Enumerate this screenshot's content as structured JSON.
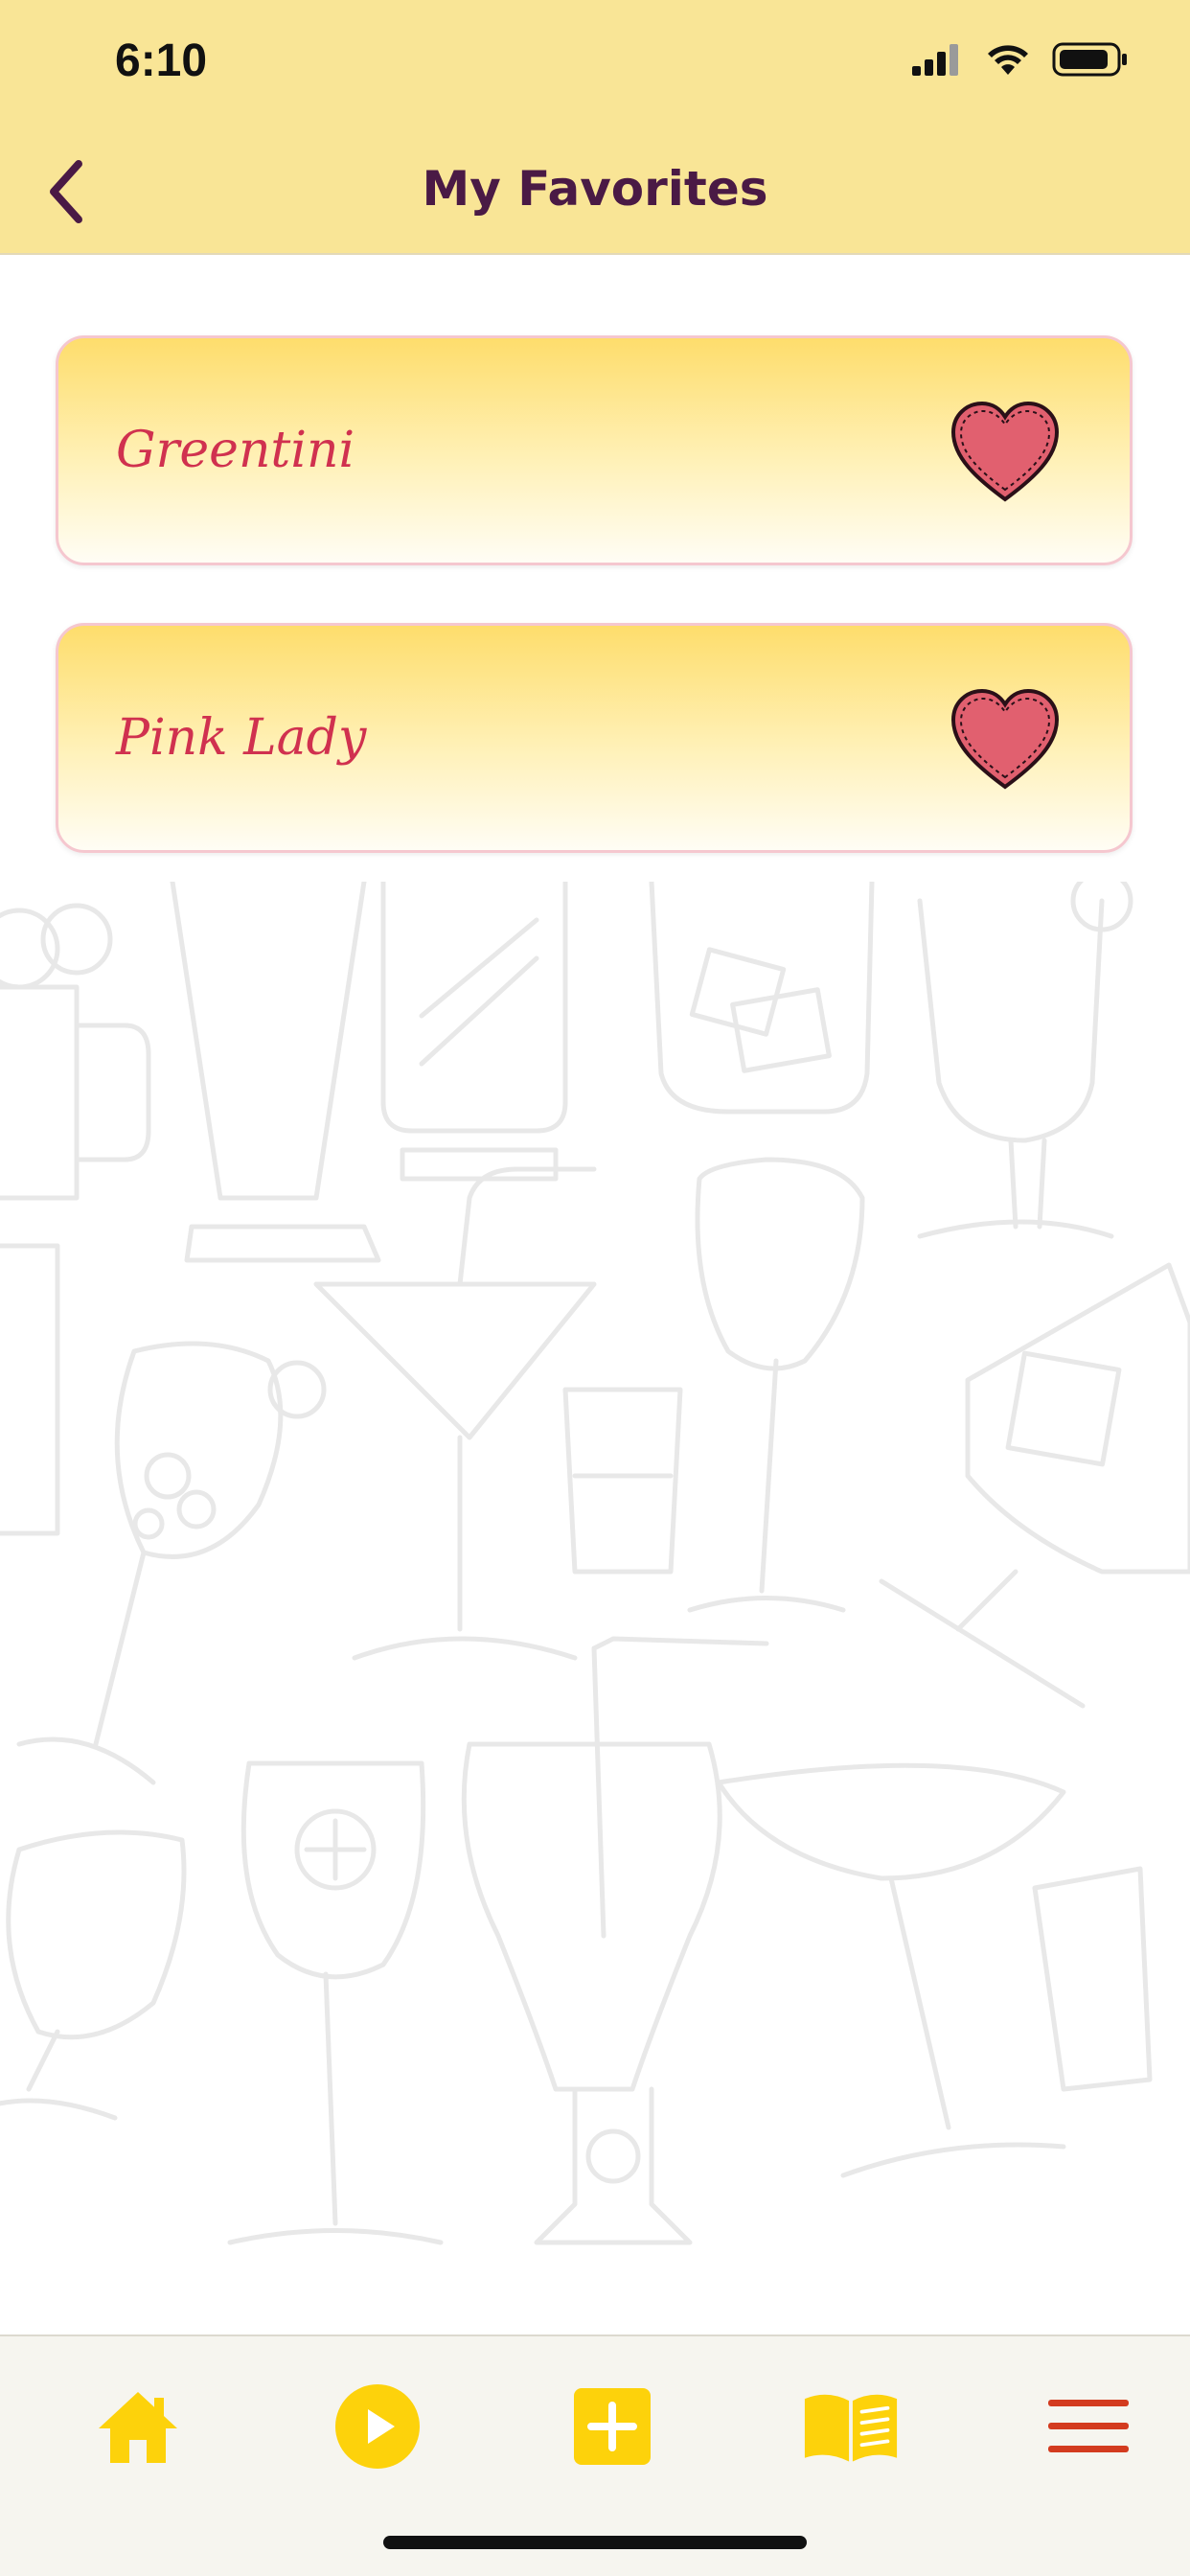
{
  "status_bar": {
    "time": "6:10"
  },
  "header": {
    "title": "My Favorites",
    "back_icon": "chevron-left-icon",
    "background_color": "#f9e596",
    "title_color": "#4a1a45"
  },
  "favorites": {
    "items": [
      {
        "label": "Greentini",
        "icon": "heart-icon"
      },
      {
        "label": "Pink Lady",
        "icon": "heart-icon"
      }
    ],
    "label_color": "#d0314f",
    "heart_color": "#e1606f"
  },
  "tab_bar": {
    "tabs": [
      {
        "name": "home",
        "icon": "home-icon"
      },
      {
        "name": "play",
        "icon": "play-icon"
      },
      {
        "name": "add",
        "icon": "plus-icon"
      },
      {
        "name": "book",
        "icon": "book-icon"
      },
      {
        "name": "menu",
        "icon": "hamburger-menu-icon"
      }
    ],
    "accent_color": "#fdd20b",
    "menu_color": "#d33b1f"
  }
}
